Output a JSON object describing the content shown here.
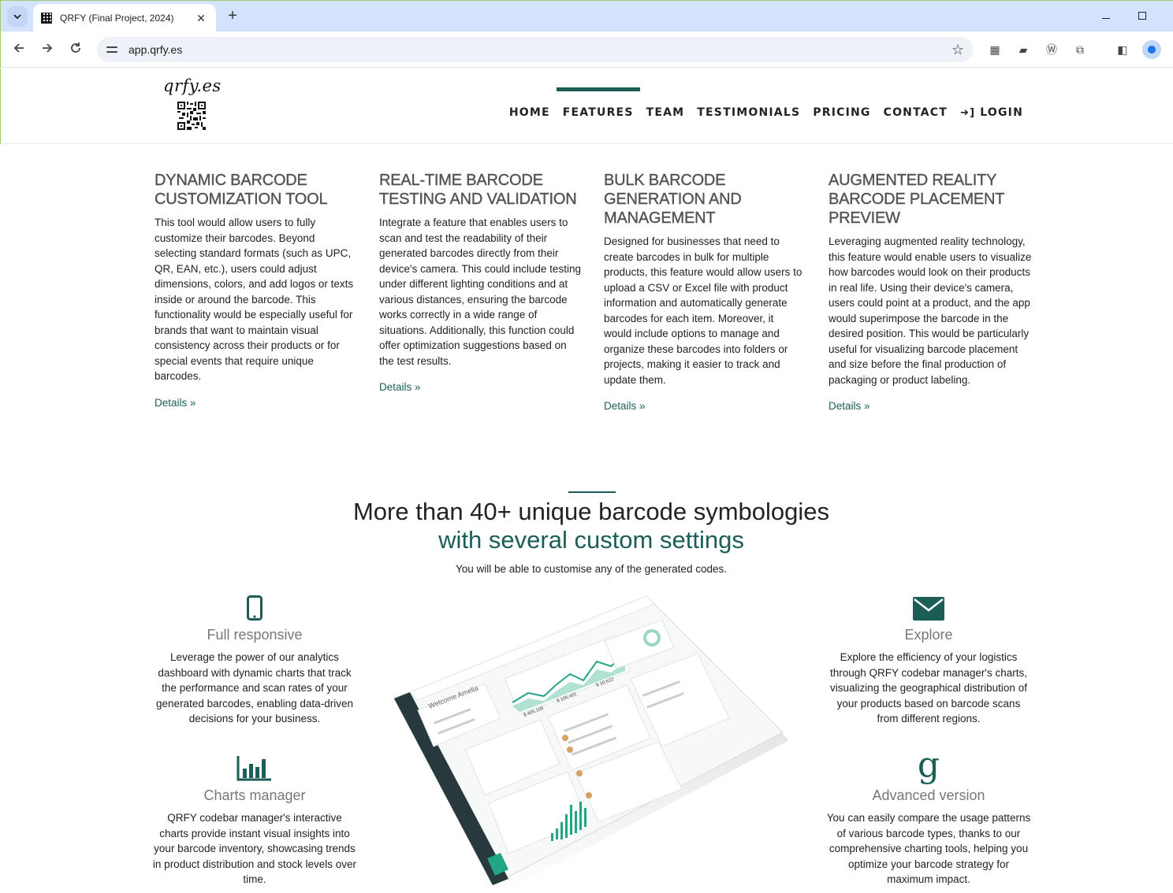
{
  "browser": {
    "tab_title": "QRFY (Final Project, 2024)",
    "url": "app.qrfy.es"
  },
  "site": {
    "logo_text": "qrfy.es",
    "nav": {
      "home": "HOME",
      "features": "FEATURES",
      "team": "TEAM",
      "testimonials": "TESTIMONIALS",
      "pricing": "PRICING",
      "contact": "CONTACT",
      "login": "LOGIN"
    }
  },
  "features": [
    {
      "title": "DYNAMIC BARCODE CUSTOMIZATION TOOL",
      "body": "This tool would allow users to fully customize their barcodes. Beyond selecting standard formats (such as UPC, QR, EAN, etc.), users could adjust dimensions, colors, and add logos or texts inside or around the barcode. This functionality would be especially useful for brands that want to maintain visual consistency across their products or for special events that require unique barcodes.",
      "link": "Details »"
    },
    {
      "title": "REAL-TIME BARCODE TESTING AND VALIDATION",
      "body": "Integrate a feature that enables users to scan and test the readability of their generated barcodes directly from their device's camera. This could include testing under different lighting conditions and at various distances, ensuring the barcode works correctly in a wide range of situations. Additionally, this function could offer optimization suggestions based on the test results.",
      "link": "Details »"
    },
    {
      "title": "BULK BARCODE GENERATION AND MANAGEMENT",
      "body": "Designed for businesses that need to create barcodes in bulk for multiple products, this feature would allow users to upload a CSV or Excel file with product information and automatically generate barcodes for each item. Moreover, it would include options to manage and organize these barcodes into folders or projects, making it easier to track and update them.",
      "link": "Details »"
    },
    {
      "title": "AUGMENTED REALITY BARCODE PLACEMENT PREVIEW",
      "body": "Leveraging augmented reality technology, this feature would enable users to visualize how barcodes would look on their products in real life. Using their device's camera, users could point at a product, and the app would superimpose the barcode in the desired position. This would be particularly useful for visualizing barcode placement and size before the final production of packaging or product labeling.",
      "link": "Details »"
    }
  ],
  "symbologies": {
    "title": "More than 40+ unique barcode symbologies",
    "subtitle": "with several custom settings",
    "description": "You will be able to customise any of the generated codes."
  },
  "info_blocks": {
    "responsive": {
      "icon": "mobile-icon",
      "title": "Full responsive",
      "body": "Leverage the power of our analytics dashboard with dynamic charts that track the performance and scan rates of your generated barcodes, enabling data-driven decisions for your business."
    },
    "charts": {
      "icon": "bar-chart-icon",
      "title": "Charts manager",
      "body": "QRFY codebar manager's interactive charts provide instant visual insights into your barcode inventory, showcasing trends in product distribution and stock levels over time."
    },
    "explore": {
      "icon": "envelope-icon",
      "title": "Explore",
      "body": "Explore the efficiency of your logistics through QRFY codebar manager's charts, visualizing the geographical distribution of your products based on barcode scans from different regions."
    },
    "advanced": {
      "icon": "google-g-icon",
      "title": "Advanced version",
      "body": "You can easily compare the usage patterns of various barcode types, thanks to our comprehensive charting tools, helping you optimize your barcode strategy for maximum impact."
    }
  },
  "dashboard_preview": {
    "welcome": "Welcome Amelia",
    "values": [
      "$ 406,100",
      "$ 106,401",
      "$ 10,622"
    ]
  },
  "colors": {
    "accent": "#1b5e57",
    "tabbar": "#d3e3fd"
  }
}
